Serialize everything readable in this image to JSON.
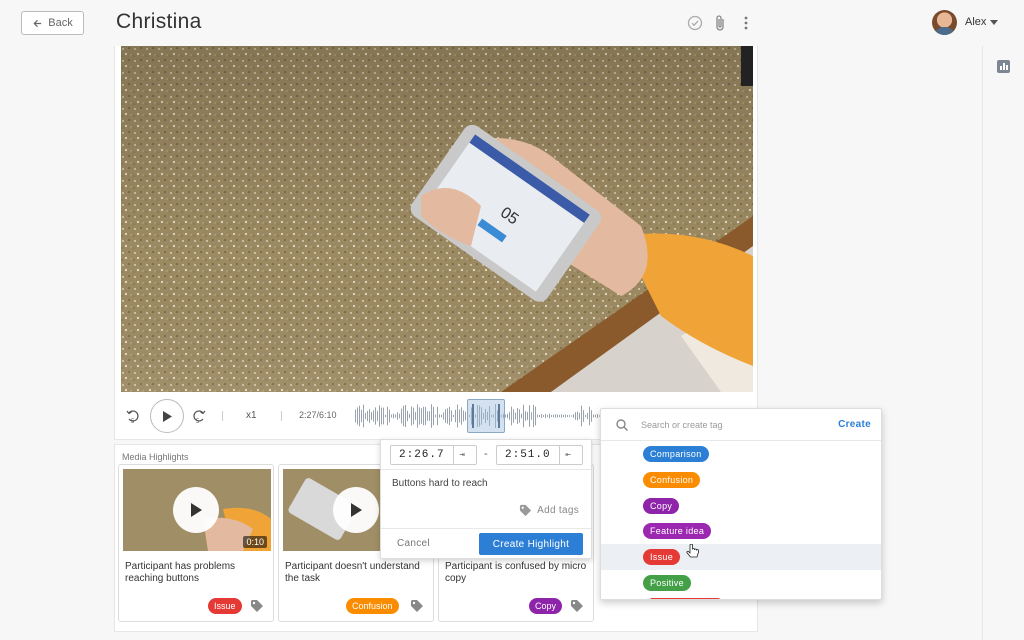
{
  "header": {
    "back_label": "Back",
    "title": "Christina",
    "user_name": "Alex"
  },
  "player": {
    "speed": "x1",
    "time": "2:27/6:10",
    "skip_back": "5",
    "skip_forward": "5"
  },
  "highlights": {
    "section_title": "Media Highlights",
    "items": [
      {
        "text": "Participant has problems reaching buttons",
        "tag": "Issue",
        "tag_color": "#e53935",
        "duration": "0:10"
      },
      {
        "text": "Participant doesn't understand the task",
        "tag": "Confusion",
        "tag_color": "#fb8c00",
        "duration": ""
      },
      {
        "text": "Participant is confused by micro copy",
        "tag": "Copy",
        "tag_color": "#8e24aa",
        "duration": ""
      }
    ]
  },
  "create_popup": {
    "start_time": "2:26.7",
    "end_time": "2:51.0",
    "note": "Buttons hard to reach",
    "add_tags_label": "Add tags",
    "cancel_label": "Cancel",
    "create_label": "Create Highlight"
  },
  "tag_dropdown": {
    "placeholder": "Search or create tag",
    "create_label": "Create",
    "tags": [
      {
        "label": "Comparison",
        "color": "#2b7fd4"
      },
      {
        "label": "Confusion",
        "color": "#fb8c00"
      },
      {
        "label": "Copy",
        "color": "#8e24aa"
      },
      {
        "label": "Feature idea",
        "color": "#9c27b0"
      },
      {
        "label": "Issue",
        "color": "#e53935"
      },
      {
        "label": "Positive",
        "color": "#43a047"
      }
    ]
  },
  "icons": [
    "arrow-left-icon",
    "check-circle-icon",
    "paperclip-icon",
    "more-vertical-icon",
    "chevron-down-icon",
    "bar-chart-icon",
    "rewind-5-icon",
    "play-icon",
    "forward-5-icon",
    "set-start-icon",
    "set-end-icon",
    "tag-icon",
    "search-icon",
    "pointer-icon"
  ]
}
